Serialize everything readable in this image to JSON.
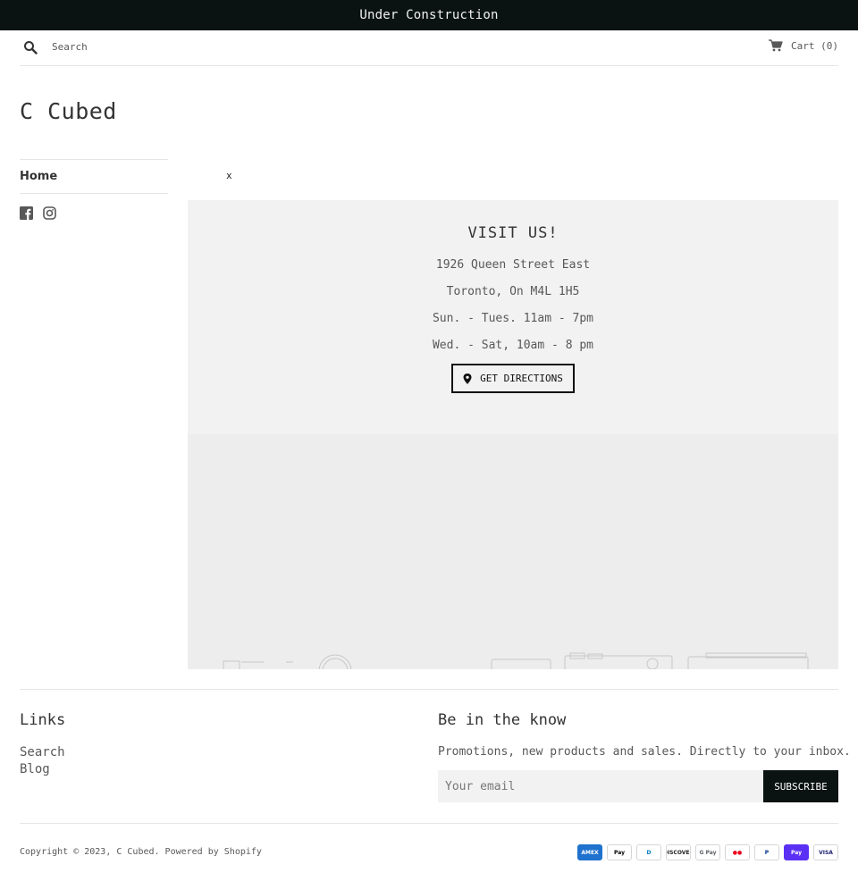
{
  "announcement": {
    "text": "Under Construction"
  },
  "header": {
    "search_placeholder": "Search",
    "cart_label": "Cart (0)"
  },
  "store": {
    "name": "C Cubed"
  },
  "sidebar": {
    "items": [
      {
        "label": "Home"
      }
    ],
    "social": [
      {
        "icon": "facebook-icon"
      },
      {
        "icon": "instagram-icon"
      }
    ]
  },
  "broken_image": {
    "text": "x"
  },
  "visit": {
    "title": "VISIT US!",
    "lines": [
      "1926 Queen Street East",
      "Toronto, On M4L 1H5",
      "Sun. - Tues. 11am - 7pm",
      "Wed. - Sat, 10am - 8 pm"
    ],
    "button_label": "GET DIRECTIONS"
  },
  "footer": {
    "links_title": "Links",
    "links": [
      {
        "label": "Search"
      },
      {
        "label": "Blog"
      }
    ],
    "newsletter_title": "Be in the know",
    "newsletter_text": "Promotions, new products and sales. Directly to your inbox.",
    "email_placeholder": "Your email",
    "subscribe_label": "SUBSCRIBE",
    "copyright": "Copyright © 2023, C Cubed. Powered by Shopify",
    "payments": [
      {
        "label": "AMEX",
        "icon": "amex-icon",
        "bg": "#1f72cd",
        "fg": "#ffffff"
      },
      {
        "label": "Pay",
        "icon": "apple-pay-icon",
        "bg": "#ffffff",
        "fg": "#000000"
      },
      {
        "label": "D",
        "icon": "diners-club-icon",
        "bg": "#ffffff",
        "fg": "#0079be"
      },
      {
        "label": "DISCOVER",
        "icon": "discover-icon",
        "bg": "#ffffff",
        "fg": "#231f20"
      },
      {
        "label": "G Pay",
        "icon": "google-pay-icon",
        "bg": "#ffffff",
        "fg": "#5f6368"
      },
      {
        "label": "●●",
        "icon": "mastercard-icon",
        "bg": "#ffffff",
        "fg": "#eb001b"
      },
      {
        "label": "P",
        "icon": "paypal-icon",
        "bg": "#ffffff",
        "fg": "#003087"
      },
      {
        "label": "Pay",
        "icon": "shop-pay-icon",
        "bg": "#5a31f4",
        "fg": "#ffffff"
      },
      {
        "label": "VISA",
        "icon": "visa-icon",
        "bg": "#ffffff",
        "fg": "#1a1f71"
      }
    ]
  }
}
